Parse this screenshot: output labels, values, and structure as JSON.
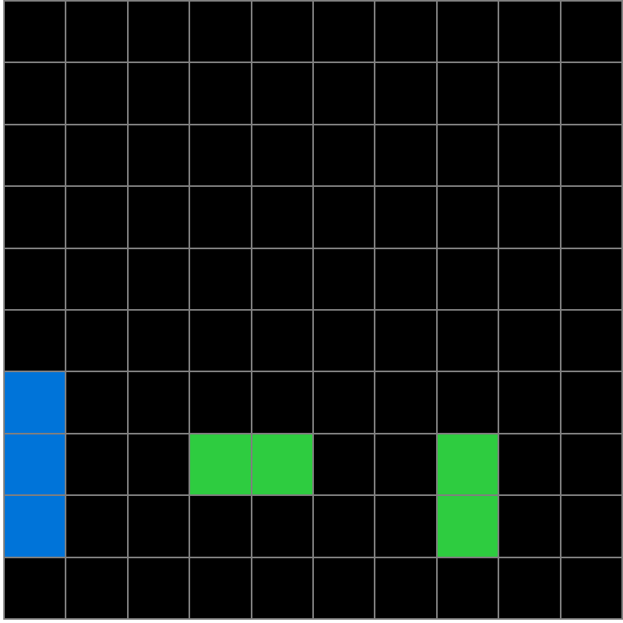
{
  "grid": {
    "rows": 10,
    "cols": 10,
    "colors": {
      "0": "#000000",
      "1": "#0074D9",
      "3": "#2ECC40"
    },
    "cells": [
      [
        0,
        0,
        0,
        0,
        0,
        0,
        0,
        0,
        0,
        0
      ],
      [
        0,
        0,
        0,
        0,
        0,
        0,
        0,
        0,
        0,
        0
      ],
      [
        0,
        0,
        0,
        0,
        0,
        0,
        0,
        0,
        0,
        0
      ],
      [
        0,
        0,
        0,
        0,
        0,
        0,
        0,
        0,
        0,
        0
      ],
      [
        0,
        0,
        0,
        0,
        0,
        0,
        0,
        0,
        0,
        0
      ],
      [
        0,
        0,
        0,
        0,
        0,
        0,
        0,
        0,
        0,
        0
      ],
      [
        1,
        0,
        0,
        0,
        0,
        0,
        0,
        0,
        0,
        0
      ],
      [
        1,
        0,
        0,
        3,
        3,
        0,
        0,
        3,
        0,
        0
      ],
      [
        1,
        0,
        0,
        0,
        0,
        0,
        0,
        3,
        0,
        0
      ],
      [
        0,
        0,
        0,
        0,
        0,
        0,
        0,
        0,
        0,
        0
      ]
    ]
  }
}
